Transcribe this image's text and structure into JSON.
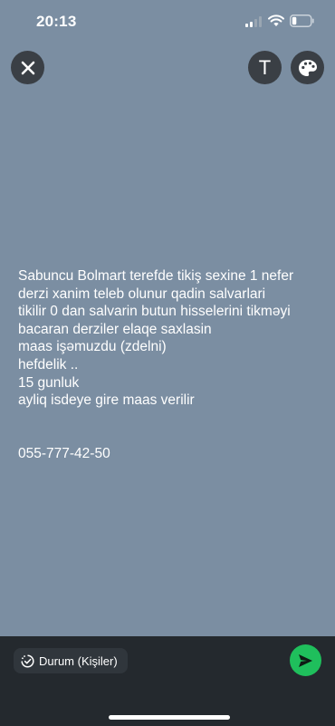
{
  "status_bar": {
    "time": "20:13"
  },
  "header": {
    "text_tool_label": "T"
  },
  "status": {
    "text": "Sabuncu Bolmart terefde tikiş sexine  1 nefer\nderzi xanim  teleb olunur  qadin salvarlari\ntikilir 0 dan salvarin butun hisselerini tikməyi\nbacaran  derziler elaqe saxlasin\nmaas işəmuzdu (zdelni)\nhefdelik ..\n15 gunluk\nayliq  isdeye gire maas verilir\n\n\n055-777-42-50",
    "background_color": "#7b8ea2"
  },
  "footer": {
    "audience_label": "Durum (Kişiler)"
  },
  "icons": {
    "close": "close-icon",
    "text": "text-tool-icon",
    "palette": "palette-icon",
    "audience": "status-ring-icon",
    "send": "send-icon"
  },
  "colors": {
    "send": "#1fbf5c",
    "bottom_bar": "#24292e"
  }
}
